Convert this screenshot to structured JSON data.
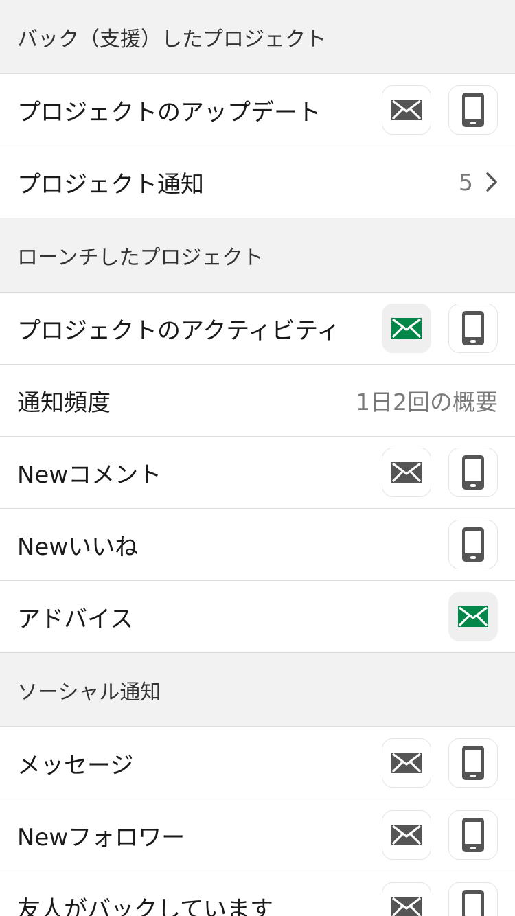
{
  "colors": {
    "accent_green": "#05874a",
    "icon_gray": "#555555",
    "header_bg": "#f2f2f2"
  },
  "sections": {
    "backed": {
      "title": "バック（支援）したプロジェクト",
      "rows": {
        "updates": {
          "label": "プロジェクトのアップデート",
          "email_on": false,
          "push_on": false
        },
        "notifications": {
          "label": "プロジェクト通知",
          "count": "5"
        }
      }
    },
    "launched": {
      "title": "ローンチしたプロジェクト",
      "rows": {
        "activity": {
          "label": "プロジェクトのアクティビティ",
          "email_on": true,
          "push_on": false
        },
        "frequency": {
          "label": "通知頻度",
          "value": "1日2回の概要"
        },
        "new_comments": {
          "label": "Newコメント",
          "email_on": false,
          "push_on": false
        },
        "new_likes": {
          "label": "Newいいね",
          "push_on": false
        },
        "advice": {
          "label": "アドバイス",
          "email_on": true
        }
      }
    },
    "social": {
      "title": "ソーシャル通知",
      "rows": {
        "messages": {
          "label": "メッセージ",
          "email_on": false,
          "push_on": false
        },
        "new_followers": {
          "label": "Newフォロワー",
          "email_on": false,
          "push_on": false
        },
        "friends_backing": {
          "label": "友人がバックしています",
          "email_on": false,
          "push_on": false
        }
      }
    }
  },
  "icons": {
    "email": "envelope-icon",
    "push": "phone-icon",
    "disclosure": "chevron-right-icon"
  }
}
